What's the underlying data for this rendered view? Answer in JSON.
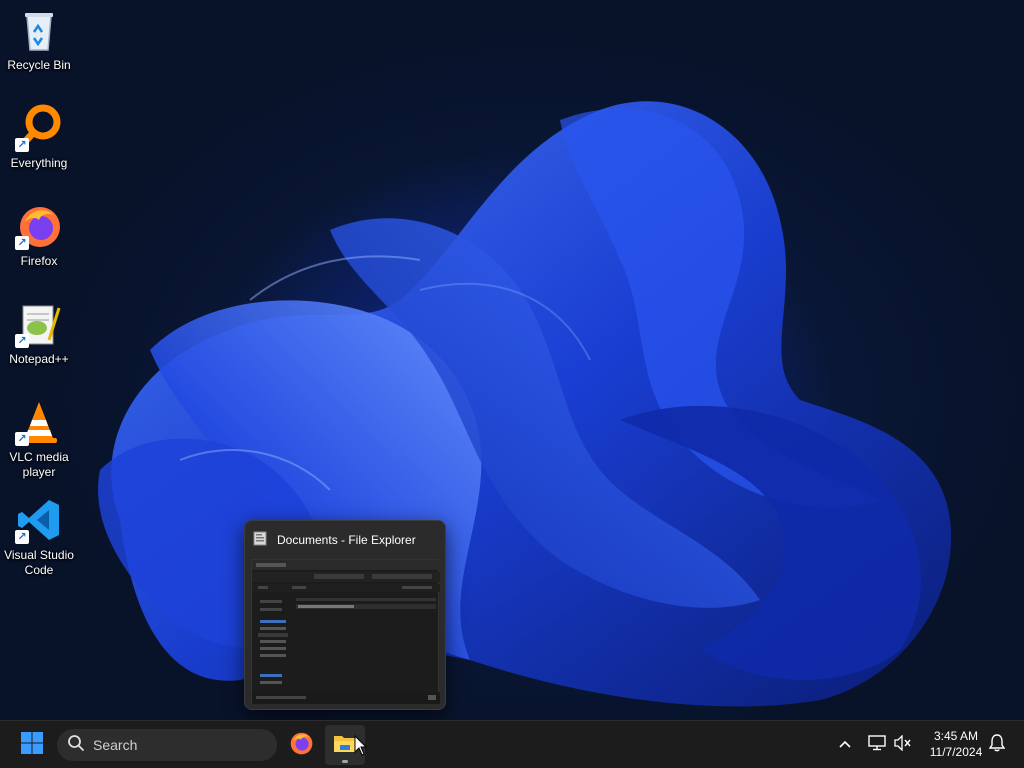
{
  "desktop": {
    "icons": [
      {
        "label": "Recycle Bin",
        "icon": "recycle-bin-icon"
      },
      {
        "label": "Everything",
        "icon": "everything-search-icon"
      },
      {
        "label": "Firefox",
        "icon": "firefox-icon"
      },
      {
        "label": "Notepad++",
        "icon": "notepadpp-icon"
      },
      {
        "label": "VLC media player",
        "icon": "vlc-icon"
      },
      {
        "label": "Visual Studio Code",
        "icon": "vscode-icon"
      }
    ]
  },
  "preview": {
    "title": "Documents - File Explorer",
    "icon": "file-explorer-icon"
  },
  "taskbar": {
    "search_placeholder": "Search",
    "time": "3:45 AM",
    "date": "11/7/2024",
    "pinned": [
      "firefox-icon",
      "file-explorer-icon"
    ],
    "tray": [
      "chevron-up-icon",
      "network-icon",
      "volume-muted-icon",
      "notification-bell-icon"
    ]
  },
  "colors": {
    "accent": "#1a6fd9",
    "taskbar_bg": "#1c1c1c",
    "wallpaper_blue": "#1436b8"
  }
}
